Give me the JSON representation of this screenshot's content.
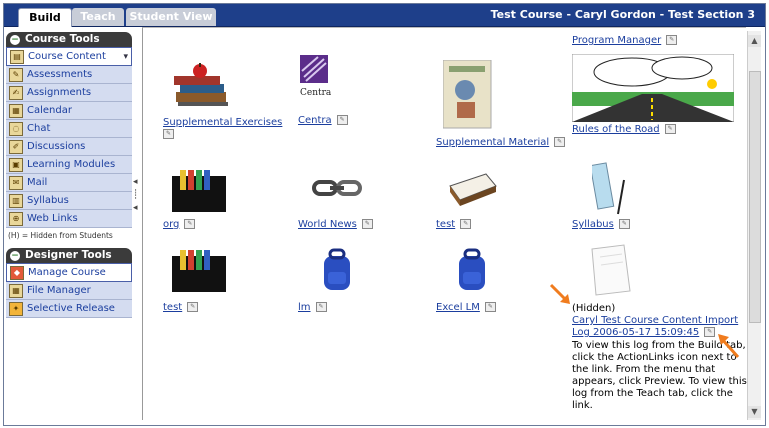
{
  "tabs": [
    {
      "label": "Build",
      "active": true
    },
    {
      "label": "Teach",
      "active": false
    },
    {
      "label": "Student View",
      "active": false
    }
  ],
  "course_title": "Test Course - Caryl Gordon - Test Section 3",
  "course_tools": {
    "heading": "Course Tools",
    "items": [
      {
        "label": "Course Content",
        "icon": "book-icon",
        "selected": true
      },
      {
        "label": "Assessments",
        "icon": "assessment-icon"
      },
      {
        "label": "Assignments",
        "icon": "assignment-icon"
      },
      {
        "label": "Calendar",
        "icon": "calendar-icon"
      },
      {
        "label": "Chat",
        "icon": "chat-icon"
      },
      {
        "label": "Discussions",
        "icon": "discussion-icon"
      },
      {
        "label": "Learning Modules",
        "icon": "module-icon"
      },
      {
        "label": "Mail",
        "icon": "mail-icon"
      },
      {
        "label": "Syllabus",
        "icon": "syllabus-icon"
      },
      {
        "label": "Web Links",
        "icon": "weblink-icon"
      }
    ],
    "hidden_note": "(H) = Hidden from Students"
  },
  "designer_tools": {
    "heading": "Designer Tools",
    "items": [
      {
        "label": "Manage Course",
        "icon": "manage-icon",
        "selected": true
      },
      {
        "label": "File Manager",
        "icon": "file-icon"
      },
      {
        "label": "Selective Release",
        "icon": "release-icon"
      }
    ]
  },
  "content_items": {
    "program_manager": "Program Manager",
    "supplemental_exercises": "Supplemental Exercises",
    "centra": "Centra",
    "centra_logo_text": "Centra",
    "supplemental_material": "Supplemental Material",
    "rules_of_the_road": "Rules of the Road",
    "org": "org",
    "world_news": "World News",
    "test1": "test",
    "syllabus": "Syllabus",
    "test2": "test",
    "lm": "lm",
    "excel_lm": "Excel LM",
    "hidden_label": "(Hidden)",
    "log_link_line1": "Caryl Test Course Content Import",
    "log_link_line2": "Log 2006-05-17 15:09:45",
    "log_description": "To view this log from the Build tab, click the ActionLinks icon next to the link. From the menu that appears, click Preview. To view this log from the Teach tab, click the link."
  },
  "colors": {
    "topbar": "#1e3f8a",
    "nav_bg": "#d4dcf0",
    "link": "#1b3e9e",
    "annotation_arrow": "#f07c1e"
  }
}
